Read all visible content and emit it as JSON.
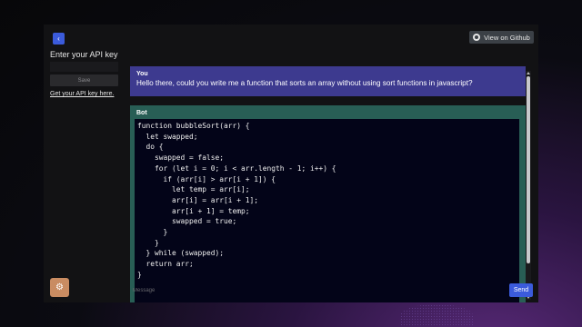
{
  "sidebar": {
    "back_label": "‹",
    "api_title": "Enter your API key",
    "api_input_placeholder": "",
    "save_label": "Save",
    "api_link": "Get your API key here.",
    "settings_icon": "⚙"
  },
  "header": {
    "github_label": "View on Github"
  },
  "chat": {
    "messages": [
      {
        "sender": "You",
        "text": "Hello there, could you write me a function that sorts an array without using sort functions in javascript?"
      },
      {
        "sender": "Bot",
        "code": "function bubbleSort(arr) {\n  let swapped;\n  do {\n    swapped = false;\n    for (let i = 0; i < arr.length - 1; i++) {\n      if (arr[i] > arr[i + 1]) {\n        let temp = arr[i];\n        arr[i] = arr[i + 1];\n        arr[i + 1] = temp;\n        swapped = true;\n      }\n    }\n  } while (swapped);\n  return arr;\n}"
      }
    ]
  },
  "footer": {
    "message_placeholder": "Message",
    "send_label": "Send"
  },
  "colors": {
    "user_bubble": "#3d3a8f",
    "bot_bubble": "#285e55",
    "accent": "#3b5bdb",
    "settings_button": "#c98c62"
  }
}
